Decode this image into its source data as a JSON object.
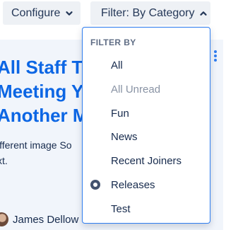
{
  "toolbar": {
    "configure_label": "Configure",
    "filter_label": "Filter: By Category"
  },
  "article": {
    "title_lines": [
      "All Staff Tow",
      "Meeting Ye",
      "Another M"
    ],
    "excerpt_lines": [
      "ifferent image So",
      "xt."
    ],
    "author": "James Dellow"
  },
  "filter_menu": {
    "heading": "FILTER BY",
    "options": [
      {
        "label": "All",
        "selected": false,
        "muted": false
      },
      {
        "label": "All Unread",
        "selected": false,
        "muted": true
      },
      {
        "label": "Fun",
        "selected": false,
        "muted": false
      },
      {
        "label": "News",
        "selected": false,
        "muted": false
      },
      {
        "label": "Recent Joiners",
        "selected": false,
        "muted": false
      },
      {
        "label": "Releases",
        "selected": true,
        "muted": false
      },
      {
        "label": "Test",
        "selected": false,
        "muted": false
      }
    ]
  },
  "icons": [
    "chevron-down-icon",
    "chevron-up-icon",
    "more-vertical-icon",
    "radio-selected-icon"
  ],
  "colors": {
    "link": "#0c66e4",
    "focus_border": "#2f7ef0",
    "button_bg": "#eef1f5",
    "card_bg": "#f1f5fb"
  }
}
